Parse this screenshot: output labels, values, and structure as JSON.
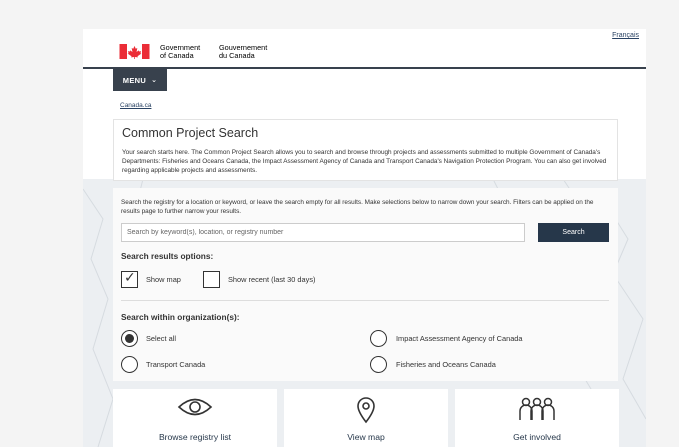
{
  "header": {
    "lang_link": "Français",
    "wordmark_en": [
      "Government",
      "of Canada"
    ],
    "wordmark_fr": [
      "Gouvernement",
      "du Canada"
    ],
    "menu_label": "MENU"
  },
  "breadcrumb": "Canada.ca",
  "intro_card": {
    "title": "Common Project Search",
    "text": "Your search starts here. The Common Project Search allows you to search and browse through projects and assessments submitted to multiple Government of Canada's Departments: Fisheries and Oceans Canada, the Impact Assessment Agency of Canada and Transport Canada's Navigation Protection Program. You can also get involved regarding applicable projects and assessments."
  },
  "search_card": {
    "description": "Search the registry for a location or keyword, or leave the search empty for all results. Make selections below to narrow down your search. Filters can be applied on the results page to further narrow your results.",
    "search_placeholder": "Search by keyword(s), location, or registry number",
    "search_button": "Search",
    "results_heading": "Search results options:",
    "show_map": {
      "label": "Show map",
      "checked": true
    },
    "show_recent": {
      "label": "Show recent (last 30 days)",
      "checked": false
    },
    "org_heading": "Search within organization(s):",
    "orgs": [
      {
        "label": "Select all",
        "selected": true
      },
      {
        "label": "Impact Assessment Agency of Canada",
        "selected": false
      },
      {
        "label": "Transport Canada",
        "selected": false
      },
      {
        "label": "Fisheries and Oceans Canada",
        "selected": false
      }
    ]
  },
  "tiles": [
    {
      "label": "Browse registry list",
      "icon": "eye-icon"
    },
    {
      "label": "View map",
      "icon": "map-pin-icon"
    },
    {
      "label": "Get involved",
      "icon": "people-icon"
    }
  ],
  "colors": {
    "navy": "#26374a",
    "menu_bg": "#38414d",
    "flag_red": "#eb2d37",
    "link": "#284162"
  }
}
